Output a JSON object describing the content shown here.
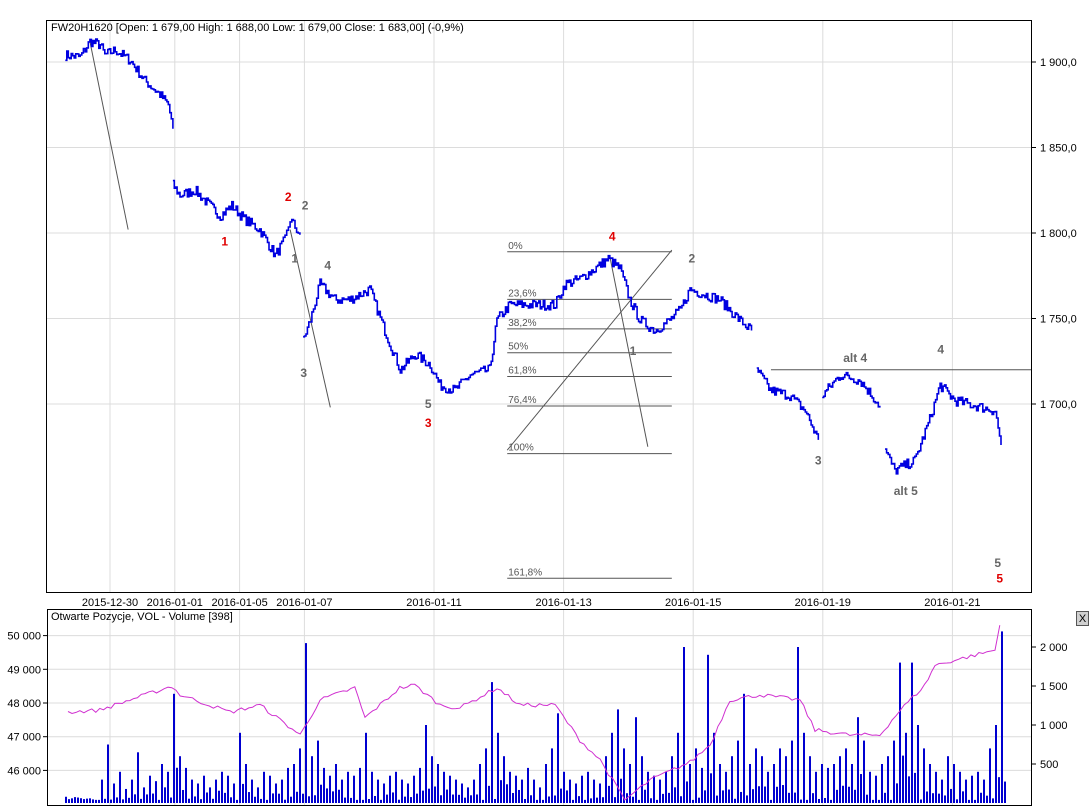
{
  "chart_data": [
    {
      "type": "line",
      "title": "FW20H1620 [Open: 1 679,00  High: 1 688,00  Low: 1 679,00  Close: 1 683,00] (-0,9%)",
      "x_unit": "trading session index (0 = 2015-12-30)",
      "x_ticks": [
        {
          "x": 0,
          "label": "2015-12-30"
        },
        {
          "x": 1,
          "label": "2016-01-01"
        },
        {
          "x": 2,
          "label": "2016-01-05"
        },
        {
          "x": 3,
          "label": "2016-01-07"
        },
        {
          "x": 5,
          "label": "2016-01-11"
        },
        {
          "x": 7,
          "label": "2016-01-13"
        },
        {
          "x": 9,
          "label": "2016-01-15"
        },
        {
          "x": 11,
          "label": "2016-01-19"
        },
        {
          "x": 13,
          "label": "2016-01-21"
        }
      ],
      "y_ticks": [
        {
          "v": 1900,
          "label": "1 900,0"
        },
        {
          "v": 1850,
          "label": "1 850,0"
        },
        {
          "v": 1800,
          "label": "1 800,0"
        },
        {
          "v": 1750,
          "label": "1 750,0"
        },
        {
          "v": 1700,
          "label": "1 700,0"
        }
      ],
      "series_color": "#0000e0",
      "price_segments": [
        [
          [
            -0.69,
            1904
          ],
          [
            -0.46,
            1903
          ],
          [
            -0.31,
            1912
          ],
          [
            -0.15,
            1910
          ],
          [
            -0.08,
            1904
          ],
          [
            0.08,
            1907
          ],
          [
            0.31,
            1901
          ],
          [
            0.54,
            1889
          ],
          [
            0.77,
            1881
          ],
          [
            0.9,
            1875
          ],
          [
            0.97,
            1861
          ]
        ],
        [
          [
            0.97,
            1828
          ],
          [
            1.08,
            1822
          ],
          [
            1.31,
            1825
          ],
          [
            1.54,
            1816
          ],
          [
            1.7,
            1810
          ],
          [
            1.88,
            1816
          ],
          [
            2.08,
            1808
          ],
          [
            2.31,
            1802
          ],
          [
            2.55,
            1787
          ],
          [
            2.7,
            1796
          ],
          [
            2.78,
            1808
          ],
          [
            2.93,
            1799
          ]
        ],
        [
          [
            2.98,
            1737
          ],
          [
            3.09,
            1749
          ],
          [
            3.24,
            1770
          ],
          [
            3.47,
            1761
          ],
          [
            3.7,
            1761
          ],
          [
            4.01,
            1767
          ],
          [
            4.24,
            1743
          ],
          [
            4.48,
            1720
          ],
          [
            4.71,
            1729
          ],
          [
            4.94,
            1723
          ],
          [
            5.09,
            1711
          ],
          [
            5.32,
            1708
          ],
          [
            5.56,
            1717
          ],
          [
            5.86,
            1720
          ],
          [
            5.97,
            1749
          ],
          [
            6.17,
            1758
          ],
          [
            6.48,
            1758
          ],
          [
            6.87,
            1758
          ],
          [
            7.02,
            1770
          ],
          [
            7.25,
            1773
          ],
          [
            7.48,
            1779
          ],
          [
            7.69,
            1785
          ],
          [
            7.87,
            1779
          ],
          [
            8.02,
            1761
          ],
          [
            8.18,
            1749
          ],
          [
            8.41,
            1743
          ],
          [
            8.64,
            1749
          ],
          [
            8.8,
            1755
          ],
          [
            8.95,
            1767
          ],
          [
            9.18,
            1764
          ],
          [
            9.41,
            1761
          ],
          [
            9.72,
            1749
          ],
          [
            9.9,
            1743
          ]
        ],
        [
          [
            9.98,
            1720
          ],
          [
            10.19,
            1708
          ],
          [
            10.49,
            1705
          ],
          [
            10.73,
            1696
          ],
          [
            10.93,
            1679
          ]
        ],
        [
          [
            10.99,
            1705
          ],
          [
            11.27,
            1717
          ],
          [
            11.57,
            1714
          ],
          [
            11.88,
            1699
          ]
        ],
        [
          [
            11.96,
            1673
          ],
          [
            12.11,
            1661
          ],
          [
            12.42,
            1667
          ],
          [
            12.65,
            1691
          ],
          [
            12.81,
            1711
          ],
          [
            13.04,
            1702
          ],
          [
            13.35,
            1699
          ],
          [
            13.66,
            1696
          ],
          [
            13.75,
            1676
          ]
        ]
      ],
      "fibonacci": {
        "x_start": 6.13,
        "x_end": 8.67,
        "high": 1789,
        "low": 1671,
        "levels": [
          {
            "r": 0,
            "label": "0%"
          },
          {
            "r": 0.236,
            "label": "23,6%"
          },
          {
            "r": 0.382,
            "label": "38,2%"
          },
          {
            "r": 0.5,
            "label": "50%"
          },
          {
            "r": 0.618,
            "label": "61,8%"
          },
          {
            "r": 0.764,
            "label": "76,4%"
          },
          {
            "r": 1,
            "label": "100%"
          },
          {
            "r": 1.618,
            "label": "161,8%"
          }
        ]
      },
      "trend_lines": [
        [
          [
            -0.31,
            1912
          ],
          [
            0.28,
            1802
          ]
        ],
        [
          [
            2.78,
            1802
          ],
          [
            3.4,
            1698
          ]
        ],
        [
          [
            6.13,
            1673
          ],
          [
            8.67,
            1790
          ]
        ],
        [
          [
            7.72,
            1785
          ],
          [
            8.3,
            1675
          ]
        ],
        [
          [
            10.2,
            1720
          ],
          [
            14.25,
            1720
          ]
        ]
      ],
      "wave_labels": [
        {
          "text": "1",
          "x": 1.77,
          "p": 1795,
          "color": "#e00000"
        },
        {
          "text": "2",
          "x": 2.75,
          "p": 1821,
          "color": "#e00000"
        },
        {
          "text": "2",
          "x": 3.01,
          "p": 1816,
          "color": "#666666"
        },
        {
          "text": "1",
          "x": 2.85,
          "p": 1785,
          "color": "#666666"
        },
        {
          "text": "4",
          "x": 3.36,
          "p": 1781,
          "color": "#666666"
        },
        {
          "text": "3",
          "x": 2.99,
          "p": 1718,
          "color": "#666666"
        },
        {
          "text": "5",
          "x": 4.91,
          "p": 1700,
          "color": "#666666"
        },
        {
          "text": "3",
          "x": 4.91,
          "p": 1689,
          "color": "#e00000"
        },
        {
          "text": "4",
          "x": 7.75,
          "p": 1798,
          "color": "#e00000"
        },
        {
          "text": "2",
          "x": 8.98,
          "p": 1785,
          "color": "#666666"
        },
        {
          "text": "1",
          "x": 8.07,
          "p": 1731,
          "color": "#666666"
        },
        {
          "text": "3",
          "x": 10.93,
          "p": 1667,
          "color": "#666666"
        },
        {
          "text": "alt 4",
          "x": 11.5,
          "p": 1727,
          "color": "#666666"
        },
        {
          "text": "4",
          "x": 12.82,
          "p": 1732,
          "color": "#666666"
        },
        {
          "text": "alt 5",
          "x": 12.28,
          "p": 1649,
          "color": "#666666"
        },
        {
          "text": "5",
          "x": 13.7,
          "p": 1607,
          "color": "#666666"
        },
        {
          "text": "5",
          "x": 13.73,
          "p": 1598,
          "color": "#e00000"
        }
      ]
    },
    {
      "type": "bar",
      "title": "Otwarte Pozycje, VOL - Volume [398]",
      "left_axis": {
        "name": "Open interest",
        "ticks": [
          {
            "v": 50000,
            "label": "50 000"
          },
          {
            "v": 49000,
            "label": "49 000"
          },
          {
            "v": 48000,
            "label": "48 000"
          },
          {
            "v": 47000,
            "label": "47 000"
          },
          {
            "v": 46000,
            "label": "46 000"
          }
        ]
      },
      "right_axis": {
        "name": "Volume",
        "ticks": [
          {
            "v": 2000,
            "label": "2 000"
          },
          {
            "v": 1500,
            "label": "1 500"
          },
          {
            "v": 1000,
            "label": "1 000"
          },
          {
            "v": 500,
            "label": "500"
          }
        ]
      },
      "volume_color": "#0000d0",
      "oi_color": "#d030d0",
      "volume": [
        80,
        60,
        70,
        50,
        60,
        40,
        300,
        750,
        250,
        400,
        180,
        300,
        650,
        200,
        350,
        280,
        500,
        400,
        1400,
        600,
        450,
        300,
        250,
        350,
        200,
        300,
        400,
        350,
        250,
        900,
        500,
        300,
        200,
        400,
        350,
        250,
        300,
        450,
        500,
        700,
        2050,
        600,
        800,
        450,
        350,
        500,
        300,
        400,
        350,
        450,
        900,
        400,
        300,
        250,
        350,
        400,
        300,
        250,
        350,
        450,
        1000,
        600,
        500,
        400,
        350,
        300,
        250,
        200,
        300,
        500,
        700,
        1550,
        900,
        600,
        400,
        350,
        300,
        450,
        300,
        200,
        500,
        700,
        1150,
        400,
        300,
        250,
        350,
        400,
        300,
        250,
        600,
        900,
        1200,
        700,
        500,
        1100,
        600,
        400,
        350,
        300,
        400,
        600,
        900,
        2000,
        500,
        700,
        450,
        1900,
        900,
        500,
        400,
        600,
        800,
        1400,
        500,
        700,
        600,
        400,
        500,
        700,
        600,
        800,
        2000,
        900,
        600,
        400,
        500,
        450,
        500,
        600,
        700,
        500,
        1100,
        800,
        400,
        350,
        500,
        600,
        800,
        1800,
        900,
        1800,
        1000,
        700,
        500,
        400,
        300,
        600,
        500,
        400,
        300,
        350,
        400,
        300,
        700,
        1000,
        2200
      ],
      "open_interest": [
        [
          0.5,
          47730
        ],
        [
          5.8,
          47790
        ],
        [
          10.8,
          48090
        ],
        [
          17.8,
          48500
        ],
        [
          19.2,
          48240
        ],
        [
          27.5,
          47730
        ],
        [
          32.5,
          47940
        ],
        [
          39.2,
          47050
        ],
        [
          42.5,
          48090
        ],
        [
          48.3,
          48450
        ],
        [
          50,
          47560
        ],
        [
          55.8,
          48450
        ],
        [
          58.3,
          48530
        ],
        [
          62.5,
          47940
        ],
        [
          65.8,
          47850
        ],
        [
          72,
          48450
        ],
        [
          75.8,
          47940
        ],
        [
          81.7,
          47940
        ],
        [
          85.8,
          46900
        ],
        [
          89.2,
          46310
        ],
        [
          93.3,
          45120
        ],
        [
          97.5,
          45710
        ],
        [
          104.2,
          46250
        ],
        [
          107.5,
          46750
        ],
        [
          110.8,
          48090
        ],
        [
          115.8,
          48240
        ],
        [
          122.5,
          48090
        ],
        [
          125,
          47200
        ],
        [
          130.8,
          47050
        ],
        [
          135.8,
          47050
        ],
        [
          139.2,
          47790
        ],
        [
          143.3,
          48530
        ],
        [
          145,
          49120
        ],
        [
          148.3,
          49270
        ],
        [
          155,
          49570
        ],
        [
          155.8,
          50310
        ]
      ]
    }
  ],
  "close_button_label": "X"
}
